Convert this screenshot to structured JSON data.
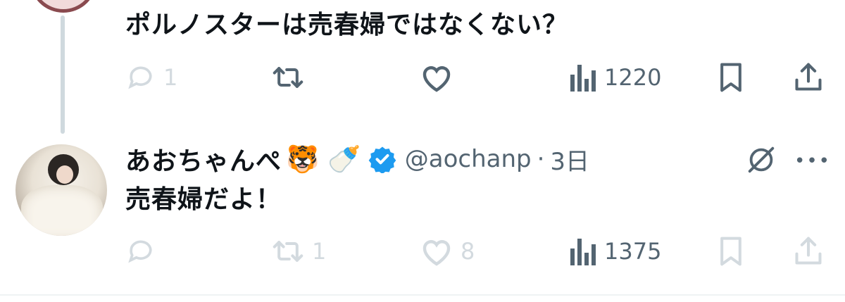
{
  "previous_tweet": {
    "text": "ポルノスターは売春婦ではなくない？",
    "actions": {
      "reply_count": "1",
      "retweet_count": "",
      "like_count": "",
      "view_count": "1220"
    }
  },
  "reply_tweet": {
    "author": {
      "display_name": "あおちゃんぺ",
      "name_emojis": "🐯 🍼",
      "handle": "@aochanp",
      "separator": "·",
      "time": "3日",
      "verified": true
    },
    "text": "売春婦だよ！",
    "actions": {
      "reply_count": "",
      "retweet_count": "1",
      "like_count": "8",
      "view_count": "1375"
    },
    "more_label": "•••"
  },
  "colors": {
    "text": "#0f1419",
    "secondary": "#536471",
    "disabled": "#d3dadf",
    "verified": "#1d9bf0",
    "thread_line": "#cfd9de"
  },
  "icons": [
    "reply-icon",
    "retweet-icon",
    "like-icon",
    "views-icon",
    "bookmark-icon",
    "share-icon",
    "verified-badge-icon",
    "grok-icon",
    "more-icon"
  ]
}
